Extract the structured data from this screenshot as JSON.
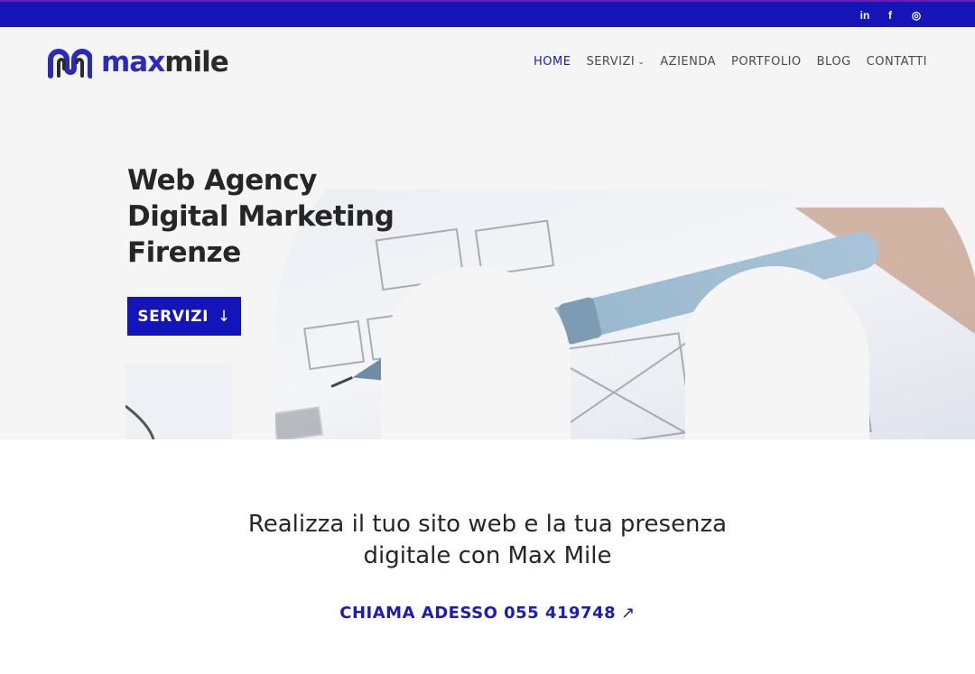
{
  "topbar": {
    "social": [
      {
        "icon": "linkedin-icon",
        "glyph": "in"
      },
      {
        "icon": "facebook-icon",
        "glyph": "f"
      },
      {
        "icon": "instagram-icon",
        "glyph": "◎"
      }
    ]
  },
  "header": {
    "logo": {
      "part1": "max",
      "part2": "mile"
    },
    "nav": [
      {
        "label": "HOME",
        "active": true
      },
      {
        "label": "SERVIZI",
        "dropdown": true
      },
      {
        "label": "AZIENDA"
      },
      {
        "label": "PORTFOLIO"
      },
      {
        "label": "BLOG"
      },
      {
        "label": "CONTATTI"
      }
    ]
  },
  "hero": {
    "title_lines": [
      "Web Agency",
      "Digital Marketing",
      "Firenze"
    ],
    "button_label": "SERVIZI",
    "button_icon": "arrow-down-icon"
  },
  "intro": {
    "tagline_lines": [
      "Realizza il tuo sito web e la tua presenza",
      "digitale con Max Mile"
    ],
    "cta_label": "CHIAMA ADESSO 055 419748",
    "cta_icon": "arrow-up-right-icon"
  },
  "colors": {
    "brand_blue": "#1414bb",
    "topbar": "#1616b8",
    "hero_bg": "#f5f5f5",
    "text_dark": "#262626"
  }
}
